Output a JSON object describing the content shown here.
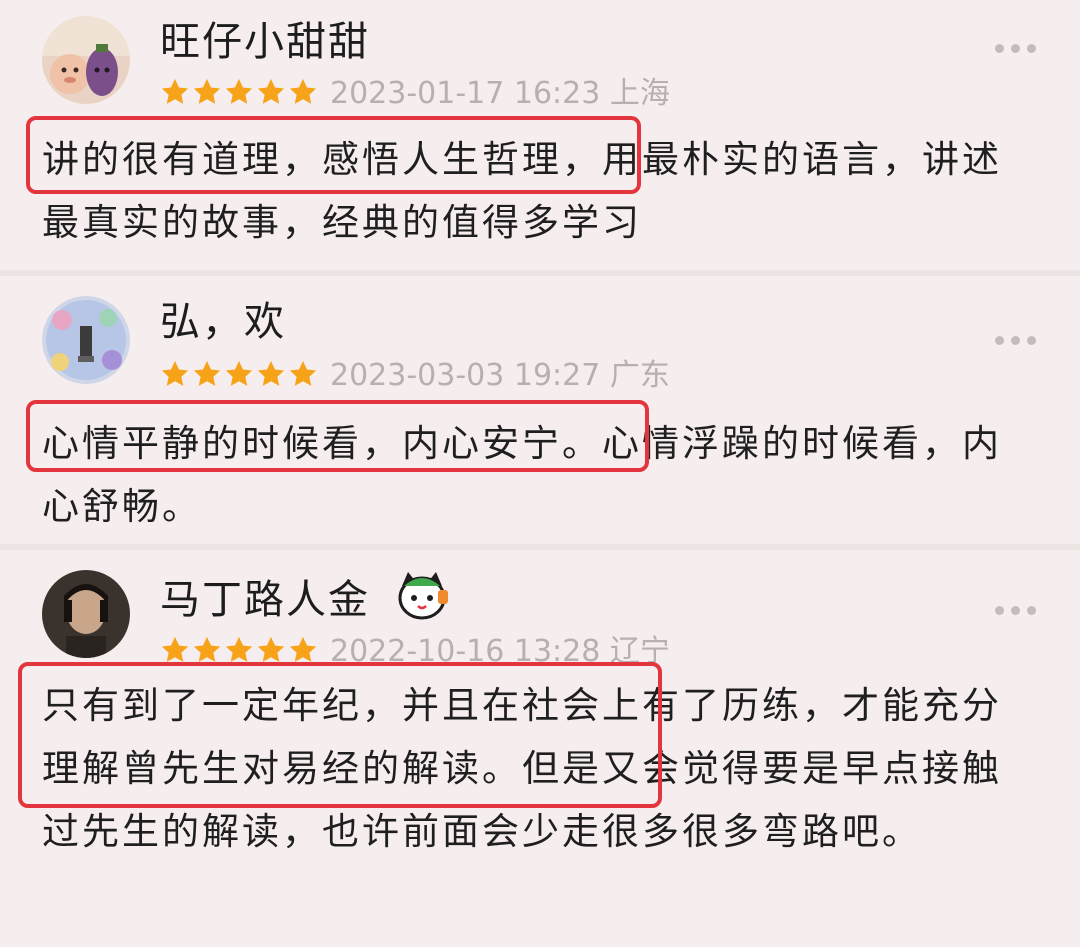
{
  "colors": {
    "background": "#f6eeee",
    "star": "#f6a31a",
    "highlight_border": "#e3353d",
    "meta_text": "#b6b0b0"
  },
  "icons": {
    "more": "more-options-icon",
    "star": "star-icon"
  },
  "reviews": [
    {
      "username": "旺仔小甜甜",
      "rating": 5,
      "date": "2023-01-17 16:23 上海",
      "text": "讲的很有道理，感悟人生哲理，用最朴实的语言，讲述最真实的故事，经典的值得多学习"
    },
    {
      "username": "弘，欢",
      "rating": 5,
      "date": "2023-03-03 19:27 广东",
      "text": "心情平静的时候看，内心安宁。心情浮躁的时候看，内心舒畅。"
    },
    {
      "username": "马丁路人金",
      "rating": 5,
      "date": "2022-10-16 13:28 辽宁",
      "text": "只有到了一定年纪，并且在社会上有了历练，才能充分理解曾先生对易经的解读。但是又会觉得要是早点接触过先生的解读，也许前面会少走很多很多弯路吧。"
    }
  ]
}
